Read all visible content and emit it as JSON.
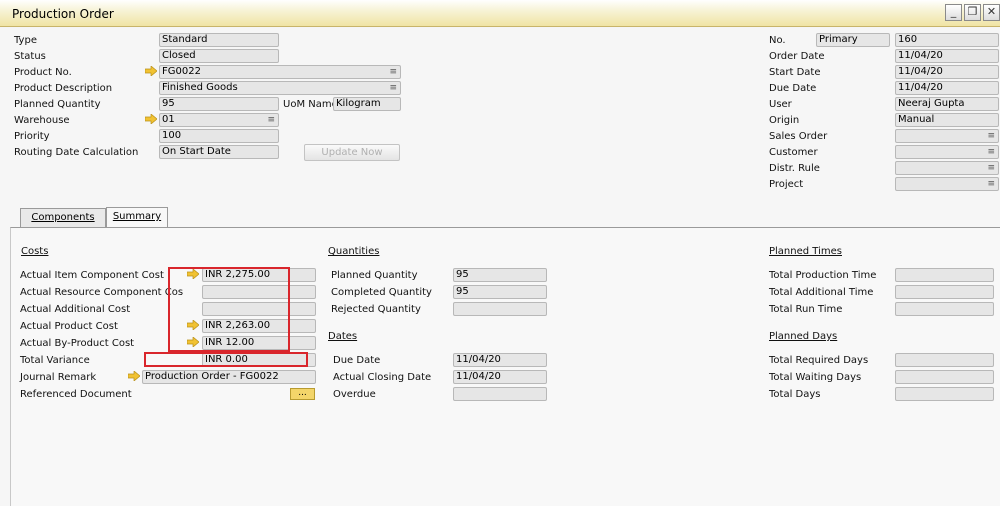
{
  "window": {
    "title": "Production Order"
  },
  "header_left": {
    "type": {
      "label": "Type",
      "value": "Standard"
    },
    "status": {
      "label": "Status",
      "value": "Closed"
    },
    "product_no": {
      "label": "Product No.",
      "value": "FG0022"
    },
    "product_description": {
      "label": "Product Description",
      "value": "Finished Goods"
    },
    "planned_quantity": {
      "label": "Planned Quantity",
      "value": "95"
    },
    "uom_name": {
      "label": "UoM Name",
      "value": "Kilogram"
    },
    "warehouse": {
      "label": "Warehouse",
      "value": "01"
    },
    "priority": {
      "label": "Priority",
      "value": "100"
    },
    "routing_date_calc": {
      "label": "Routing Date Calculation",
      "value": "On Start Date"
    },
    "update_now_label": "Update Now"
  },
  "header_right": {
    "no": {
      "label": "No.",
      "series": "Primary",
      "value": "160"
    },
    "order_date": {
      "label": "Order Date",
      "value": "11/04/20"
    },
    "start_date": {
      "label": "Start Date",
      "value": "11/04/20"
    },
    "due_date": {
      "label": "Due Date",
      "value": "11/04/20"
    },
    "user": {
      "label": "User",
      "value": "Neeraj Gupta"
    },
    "origin": {
      "label": "Origin",
      "value": "Manual"
    },
    "sales_order": {
      "label": "Sales Order",
      "value": ""
    },
    "customer": {
      "label": "Customer",
      "value": ""
    },
    "distr_rule": {
      "label": "Distr. Rule",
      "value": ""
    },
    "project": {
      "label": "Project",
      "value": ""
    }
  },
  "tabs": [
    {
      "label": "Components",
      "active": false
    },
    {
      "label": "Summary",
      "active": true
    }
  ],
  "summary": {
    "costs": {
      "heading": "Costs",
      "actual_item_component_cost": {
        "label": "Actual Item Component Cost",
        "value": "INR 2,275.00"
      },
      "actual_resource_component_cost": {
        "label": "Actual Resource Component Cos",
        "value": ""
      },
      "actual_additional_cost": {
        "label": "Actual Additional Cost",
        "value": ""
      },
      "actual_product_cost": {
        "label": "Actual Product Cost",
        "value": "INR 2,263.00"
      },
      "actual_by_product_cost": {
        "label": "Actual By-Product Cost",
        "value": "INR 12.00"
      },
      "total_variance": {
        "label": "Total Variance",
        "value": "INR 0.00"
      },
      "journal_remark": {
        "label": "Journal Remark",
        "value": "Production Order - FG0022"
      },
      "referenced_document": {
        "label": "Referenced Document",
        "button": "..."
      }
    },
    "quantities": {
      "heading": "Quantities",
      "planned_quantity": {
        "label": "Planned Quantity",
        "value": "95"
      },
      "completed_quantity": {
        "label": "Completed Quantity",
        "value": "95"
      },
      "rejected_quantity": {
        "label": "Rejected Quantity",
        "value": ""
      }
    },
    "dates": {
      "heading": "Dates",
      "due_date": {
        "label": "Due Date",
        "value": "11/04/20"
      },
      "actual_closing_date": {
        "label": "Actual Closing Date",
        "value": "11/04/20"
      },
      "overdue": {
        "label": "Overdue",
        "value": ""
      }
    },
    "planned_times": {
      "heading": "Planned Times",
      "total_production_time": {
        "label": "Total Production Time",
        "value": ""
      },
      "total_additional_time": {
        "label": "Total Additional Time",
        "value": ""
      },
      "total_run_time": {
        "label": "Total Run Time",
        "value": ""
      }
    },
    "planned_days": {
      "heading": "Planned Days",
      "total_required_days": {
        "label": "Total Required Days",
        "value": ""
      },
      "total_waiting_days": {
        "label": "Total Waiting Days",
        "value": ""
      },
      "total_days": {
        "label": "Total Days",
        "value": ""
      }
    }
  },
  "colors": {
    "highlight_box": "#d9262c",
    "link_arrow": "#f1c232",
    "titlebar": "#f0e4a4"
  }
}
